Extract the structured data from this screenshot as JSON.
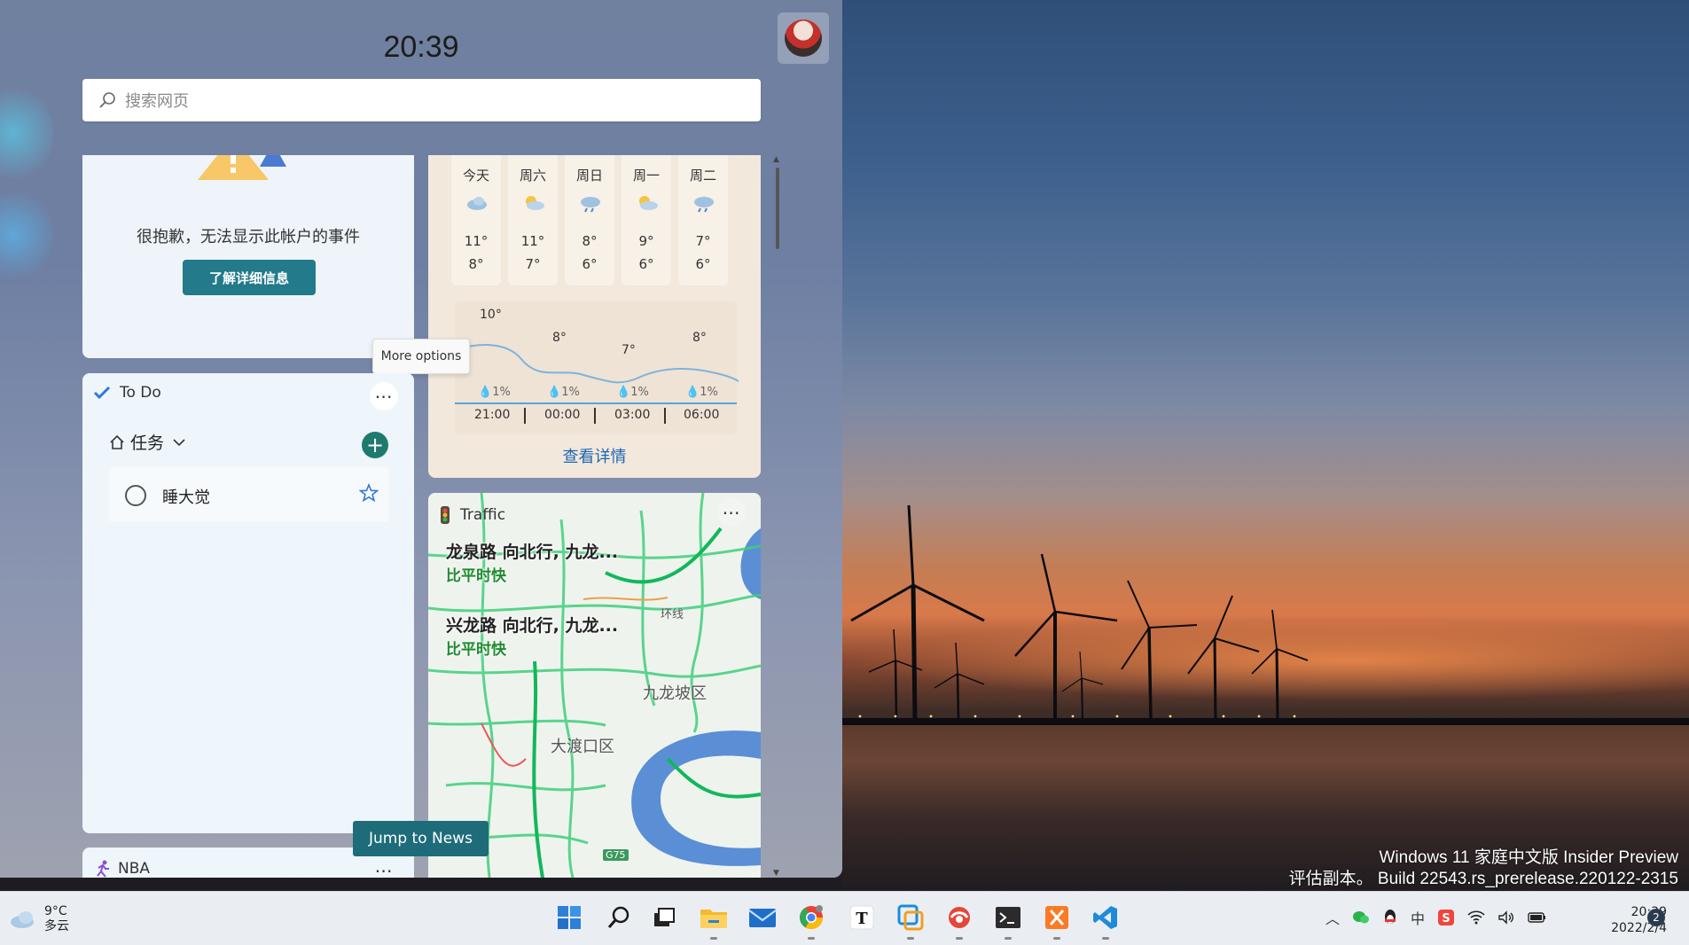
{
  "panel": {
    "clock": "20:39",
    "search_placeholder": "搜索网页"
  },
  "calendar": {
    "message": "很抱歉，无法显示此帐户的事件",
    "button": "了解详细信息"
  },
  "tooltip": "More options",
  "todo": {
    "title": "To Do",
    "list_name": "任务",
    "items": [
      {
        "text": "睡大觉"
      }
    ]
  },
  "weather": {
    "forecast": [
      {
        "day": "今天",
        "high": "11°",
        "low": "8°",
        "icon": "cloudy-icon"
      },
      {
        "day": "周六",
        "high": "11°",
        "low": "7°",
        "icon": "partly-sunny-icon"
      },
      {
        "day": "周日",
        "high": "8°",
        "low": "6°",
        "icon": "rain-icon"
      },
      {
        "day": "周一",
        "high": "9°",
        "low": "6°",
        "icon": "partly-sunny-icon"
      },
      {
        "day": "周二",
        "high": "7°",
        "low": "6°",
        "icon": "rain-icon"
      }
    ],
    "hourly": {
      "temps": [
        "10°",
        "8°",
        "7°",
        "8°"
      ],
      "rain": [
        "1%",
        "1%",
        "1%",
        "1%"
      ],
      "times": [
        "21:00",
        "00:00",
        "03:00",
        "06:00"
      ]
    },
    "details_link": "查看详情"
  },
  "traffic": {
    "title": "Traffic",
    "routes": [
      {
        "road": "龙泉路 向北行, 九龙...",
        "status": "比平时快"
      },
      {
        "road": "兴龙路 向北行, 九龙...",
        "status": "比平时快"
      }
    ],
    "map_labels": [
      "九龙坡区",
      "大渡口区",
      "环线",
      "G75"
    ]
  },
  "nba": {
    "title": "NBA"
  },
  "jump_to_news": "Jump to News",
  "watermark": {
    "line1": "Windows 11 家庭中文版 Insider Preview",
    "line2": "评估副本。 Build 22543.rs_prerelease.220122-2315"
  },
  "taskbar": {
    "weather_temp": "9°C",
    "weather_cond": "多云",
    "apps": [
      "start-icon",
      "search-icon",
      "task-view-icon",
      "file-explorer-icon",
      "mail-icon",
      "chrome-icon",
      "typora-icon",
      "app-store-icon",
      "browser-icon",
      "terminal-icon",
      "xampp-icon",
      "vscode-icon"
    ],
    "time": "20:39",
    "date": "2022/2/4",
    "notifications": "2",
    "ime": "中"
  },
  "colors": {
    "accent": "#237a8a",
    "todo_add": "#1f7a6e",
    "traffic_fast": "#1f8b2f",
    "link": "#1d66b3"
  }
}
